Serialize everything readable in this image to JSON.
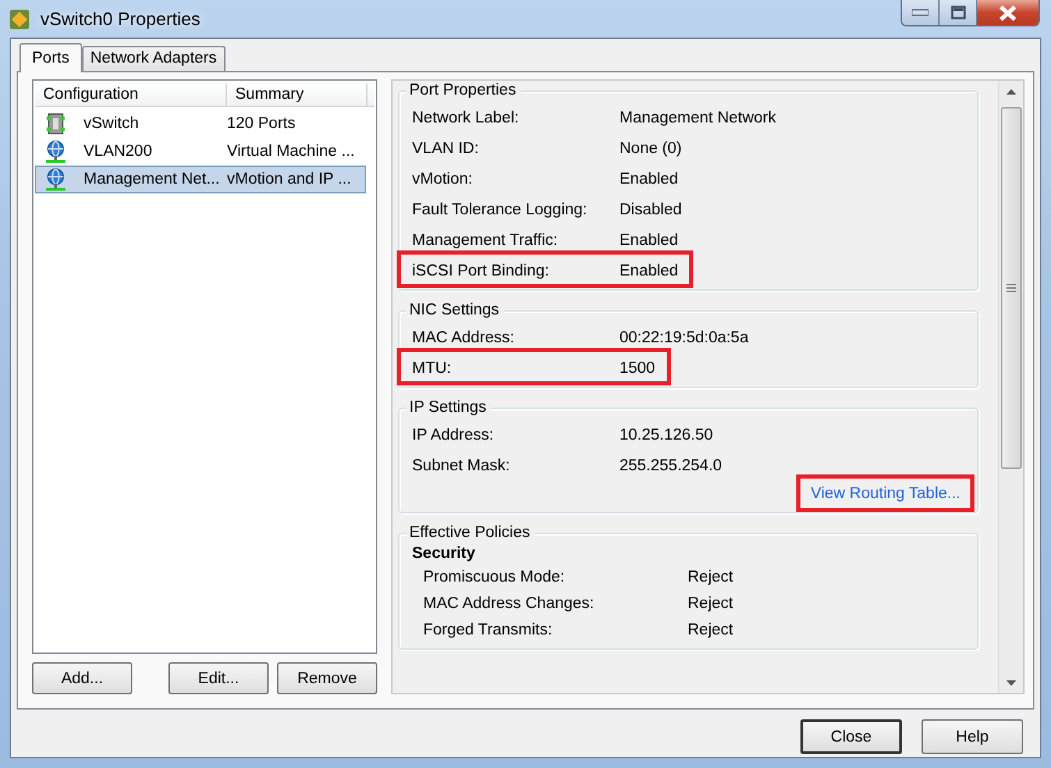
{
  "window": {
    "title": "vSwitch0 Properties"
  },
  "tabs": [
    {
      "label": "Ports",
      "selected": true
    },
    {
      "label": "Network Adapters",
      "selected": false
    }
  ],
  "port_list": {
    "columns": [
      "Configuration",
      "Summary"
    ],
    "rows": [
      {
        "kind": "switch",
        "configuration": "vSwitch",
        "summary": "120 Ports",
        "selected": false
      },
      {
        "kind": "portgroup",
        "configuration": "VLAN200",
        "summary": "Virtual Machine ...",
        "selected": false
      },
      {
        "kind": "portgroup",
        "configuration": "Management Net...",
        "summary": "vMotion and IP ...",
        "selected": true
      }
    ]
  },
  "list_buttons": [
    "Add...",
    "Edit...",
    "Remove"
  ],
  "groups": [
    {
      "title": "Port Properties",
      "rows": [
        {
          "label": "Network Label:",
          "value": "Management Network",
          "highlighted": false
        },
        {
          "label": "VLAN ID:",
          "value": "None (0)",
          "highlighted": false
        },
        {
          "label": "vMotion:",
          "value": "Enabled",
          "highlighted": false
        },
        {
          "label": "Fault Tolerance Logging:",
          "value": "Disabled",
          "highlighted": false
        },
        {
          "label": "Management Traffic:",
          "value": "Enabled",
          "highlighted": false
        },
        {
          "label": "iSCSI Port Binding:",
          "value": "Enabled",
          "highlighted": true
        }
      ]
    },
    {
      "title": "NIC Settings",
      "rows": [
        {
          "label": "MAC Address:",
          "value": "00:22:19:5d:0a:5a",
          "highlighted": false
        },
        {
          "label": "MTU:",
          "value": "1500",
          "highlighted": true
        }
      ]
    },
    {
      "title": "IP Settings",
      "rows": [
        {
          "label": "IP Address:",
          "value": "10.25.126.50",
          "highlighted": false
        },
        {
          "label": "Subnet Mask:",
          "value": "255.255.254.0",
          "highlighted": false
        }
      ],
      "link": {
        "text": "View Routing Table...",
        "highlighted": true
      }
    },
    {
      "title": "Effective Policies",
      "heading": "Security",
      "rows": [
        {
          "label": "Promiscuous Mode:",
          "value": "Reject",
          "highlighted": false
        },
        {
          "label": "MAC Address Changes:",
          "value": "Reject",
          "highlighted": false
        },
        {
          "label": "Forged Transmits:",
          "value": "Reject",
          "highlighted": false
        }
      ]
    }
  ],
  "buttons": [
    {
      "label": "Close",
      "default": true
    },
    {
      "label": "Help",
      "default": false
    }
  ]
}
